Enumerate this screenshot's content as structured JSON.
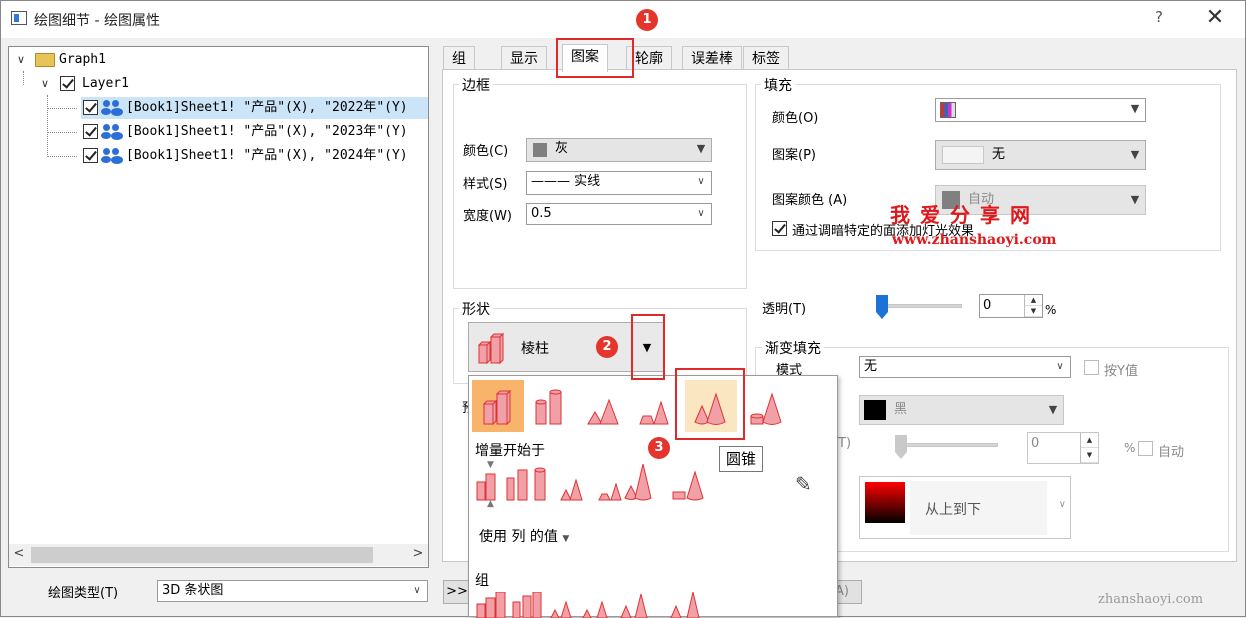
{
  "window": {
    "title": "绘图细节 - 绘图属性",
    "help_label": "?",
    "close_label": "✕"
  },
  "tree": {
    "root": "Graph1",
    "layer": "Layer1",
    "items": [
      "[Book1]Sheet1! \"产品\"(X), \"2022年\"(Y)",
      "[Book1]Sheet1! \"产品\"(X), \"2023年\"(Y)",
      "[Book1]Sheet1! \"产品\"(X), \"2024年\"(Y)"
    ]
  },
  "bottom": {
    "plot_type_label": "绘图类型(T)",
    "plot_type_value": "3D 条状图",
    "expand_label": ">>",
    "apply_label": "A)"
  },
  "tabs": [
    "组",
    "显示",
    "图案",
    "轮廓",
    "误差棒",
    "标签"
  ],
  "active_tab": "图案",
  "border": {
    "title": "边框",
    "color_label": "颜色(C)",
    "color_value": "灰",
    "color_hex": "#808080",
    "style_label": "样式(S)",
    "style_value": "——— 实线",
    "width_label": "宽度(W)",
    "width_value": "0.5"
  },
  "fill": {
    "title": "填充",
    "color_label": "颜色(O)",
    "pattern_label": "图案(P)",
    "pattern_value": "无",
    "pattern_color_label": "图案颜色 (A)",
    "pattern_color_value": "自动",
    "lighting_label": "通过调暗特定的面添加灯光效果"
  },
  "shape": {
    "title": "形状",
    "value": "棱柱"
  },
  "transparency": {
    "label": "透明(T)",
    "value": "0",
    "unit": "%"
  },
  "gradient": {
    "title": "渐变填充",
    "mode_label": "模式",
    "mode_value": "无",
    "by_y_label": "按Y值",
    "color_value": "黑",
    "spin_value": "0",
    "percent": "%",
    "auto_label": "自动",
    "direction_value": "从上到下",
    "hidden_label_t": "T)"
  },
  "popup": {
    "increment_label": "增量开始于",
    "use_label": "使用 列 的值",
    "group_label": "组"
  },
  "tooltip": "圆锥",
  "badges": [
    "1",
    "2",
    "3"
  ],
  "watermark": {
    "cn": "我爱分享网",
    "url": "www.zhanshaoyi.com",
    "corner": "zhanshaoyi.com"
  },
  "colors": {
    "accent": "#e02a2a",
    "shape_fill": "#f2a0a8",
    "selected_cell": "#f7b46a",
    "hover_cell": "#fbe6c2"
  }
}
